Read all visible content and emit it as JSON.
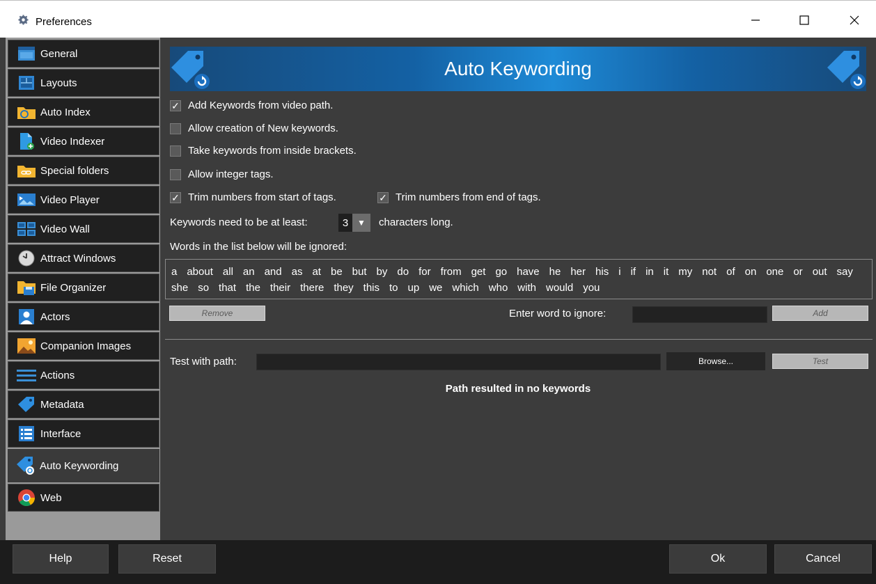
{
  "window": {
    "title": "Preferences",
    "controls": [
      "minimize-icon",
      "maximize-icon",
      "close-icon"
    ]
  },
  "sidebar": {
    "items": [
      {
        "label": "General",
        "icon": "window-icon"
      },
      {
        "label": "Layouts",
        "icon": "layout-icon"
      },
      {
        "label": "Auto Index",
        "icon": "folder-refresh-icon"
      },
      {
        "label": "Video Indexer",
        "icon": "file-add-icon"
      },
      {
        "label": "Special folders",
        "icon": "folder-link-icon"
      },
      {
        "label": "Video Player",
        "icon": "video-player-icon"
      },
      {
        "label": "Video Wall",
        "icon": "video-wall-icon"
      },
      {
        "label": "Attract Windows",
        "icon": "clock-icon"
      },
      {
        "label": "File Organizer",
        "icon": "folder-save-icon"
      },
      {
        "label": "Actors",
        "icon": "person-icon"
      },
      {
        "label": "Companion Images",
        "icon": "image-icon"
      },
      {
        "label": "Actions",
        "icon": "menu-lines-icon"
      },
      {
        "label": "Metadata",
        "icon": "tag-icon"
      },
      {
        "label": "Interface",
        "icon": "interface-list-icon"
      },
      {
        "label": "Auto Keywording",
        "icon": "tag-refresh-icon",
        "active": true
      },
      {
        "label": "Web",
        "icon": "chrome-icon"
      }
    ]
  },
  "header": {
    "title": "Auto Keywording"
  },
  "options": {
    "add_from_path": {
      "label": "Add Keywords from video path.",
      "checked": true
    },
    "allow_new": {
      "label": "Allow creation of New keywords.",
      "checked": false
    },
    "inside_brackets": {
      "label": "Take keywords from inside brackets.",
      "checked": false
    },
    "integer_tags": {
      "label": "Allow integer tags.",
      "checked": false
    },
    "trim_start": {
      "label": "Trim numbers from start of tags.",
      "checked": true
    },
    "trim_end": {
      "label": "Trim numbers from end of tags.",
      "checked": true
    }
  },
  "min_length": {
    "prefix": "Keywords need to be at least:",
    "value": "3",
    "suffix": "characters long."
  },
  "ignore": {
    "label": "Words in the list below will be ignored:",
    "words": [
      "a",
      "about",
      "all",
      "an",
      "and",
      "as",
      "at",
      "be",
      "but",
      "by",
      "do",
      "for",
      "from",
      "get",
      "go",
      "have",
      "he",
      "her",
      "his",
      "i",
      "if",
      "in",
      "it",
      "my",
      "not",
      "of",
      "on",
      "one",
      "or",
      "out",
      "say",
      "she",
      "so",
      "that",
      "the",
      "their",
      "there",
      "they",
      "this",
      "to",
      "up",
      "we",
      "which",
      "who",
      "with",
      "would",
      "you"
    ],
    "remove_label": "Remove",
    "enter_label": "Enter word to ignore:",
    "enter_value": "",
    "add_label": "Add"
  },
  "test": {
    "label": "Test with path:",
    "path_value": "",
    "browse_label": "Browse...",
    "test_label": "Test",
    "result": "Path resulted in no keywords"
  },
  "footer": {
    "help": "Help",
    "reset": "Reset",
    "ok": "Ok",
    "cancel": "Cancel"
  },
  "colors": {
    "accent": "#1e8ad6",
    "panel": "#3c3c3c",
    "sidebar_item": "#202020"
  }
}
